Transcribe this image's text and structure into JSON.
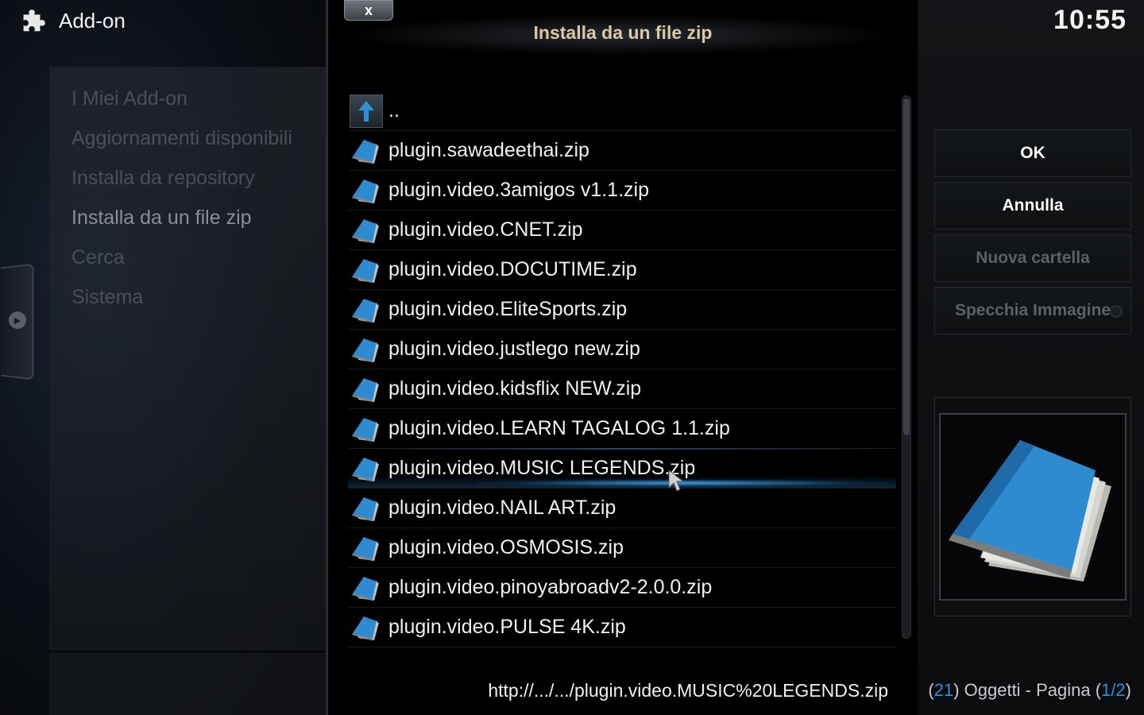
{
  "header": {
    "title": "Add-on",
    "icon": "puzzle-icon",
    "clock": "10:55"
  },
  "sidebar": {
    "items": [
      {
        "label": "I Miei Add-on",
        "active": false
      },
      {
        "label": "Aggiornamenti disponibili",
        "active": false
      },
      {
        "label": "Installa da repository",
        "active": false
      },
      {
        "label": "Installa da un file zip",
        "active": true
      },
      {
        "label": "Cerca",
        "active": false
      },
      {
        "label": "Sistema",
        "active": false
      }
    ]
  },
  "dialog": {
    "title": "Installa da un file zip",
    "close_label": "x",
    "parent_label": "..",
    "files": [
      "plugin.sawadeethai.zip",
      "plugin.video.3amigos v1.1.zip",
      "plugin.video.CNET.zip",
      "plugin.video.DOCUTIME.zip",
      "plugin.video.EliteSports.zip",
      "plugin.video.justlego new.zip",
      "plugin.video.kidsflix NEW.zip",
      "plugin.video.LEARN TAGALOG 1.1.zip",
      "plugin.video.MUSIC LEGENDS.zip",
      "plugin.video.NAIL ART.zip",
      "plugin.video.OSMOSIS.zip",
      "plugin.video.pinoyabroadv2-2.0.0.zip",
      "plugin.video.PULSE 4K.zip"
    ],
    "selected_index": 8,
    "path": "http://.../.../plugin.video.MUSIC%20LEGENDS.zip"
  },
  "buttons": {
    "ok": "OK",
    "cancel": "Annulla",
    "new_folder": "Nuova cartella",
    "mirror_image": "Specchia Immagine"
  },
  "status": {
    "count": "21",
    "objects_label": "Oggetti - Pagina",
    "page": "1/2"
  },
  "colors": {
    "accent": "#2f8fd8",
    "title": "#d9c9a8"
  }
}
